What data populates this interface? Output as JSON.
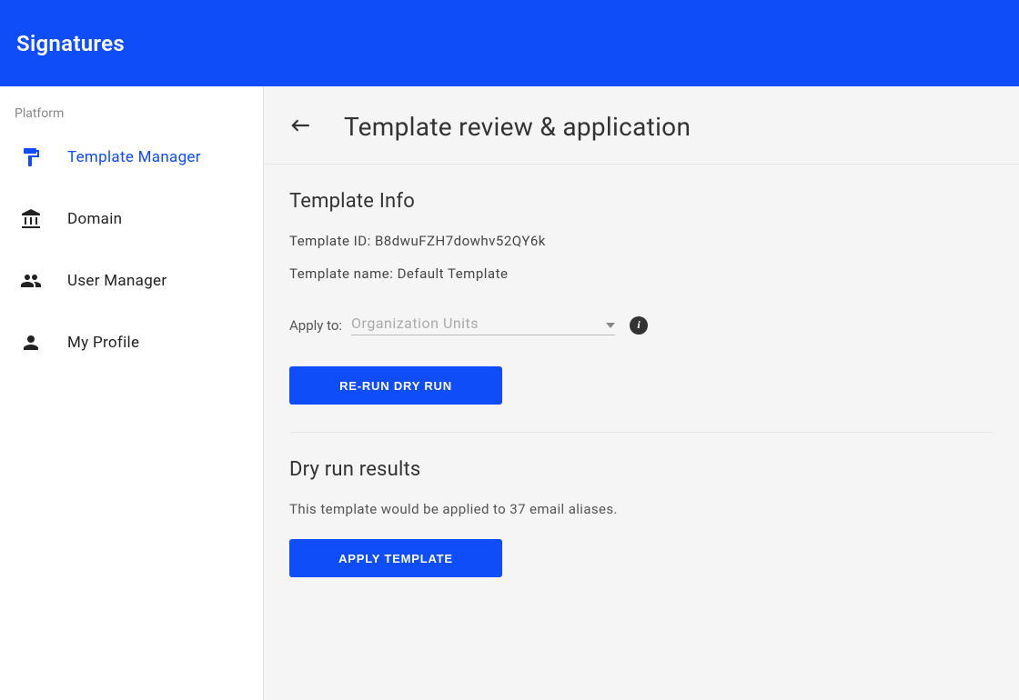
{
  "header": {
    "title": "Signatures"
  },
  "sidebar": {
    "section_label": "Platform",
    "items": [
      {
        "label": "Template Manager",
        "icon": "format-paint-icon",
        "active": true
      },
      {
        "label": "Domain",
        "icon": "domain-icon",
        "active": false
      },
      {
        "label": "User Manager",
        "icon": "users-icon",
        "active": false
      },
      {
        "label": "My Profile",
        "icon": "person-icon",
        "active": false
      }
    ]
  },
  "main": {
    "page_title": "Template review & application",
    "template_info": {
      "heading": "Template Info",
      "id_label": "Template ID:",
      "id_value": "B8dwuFZH7dowhv52QY6k",
      "name_label": "Template name:",
      "name_value": "Default Template",
      "apply_label": "Apply to:",
      "apply_placeholder": "Organization Units",
      "rerun_button": "RE-RUN DRY RUN"
    },
    "dry_run": {
      "heading": "Dry run results",
      "summary": "This template would be applied to 37 email aliases.",
      "apply_button": "APPLY TEMPLATE"
    }
  }
}
